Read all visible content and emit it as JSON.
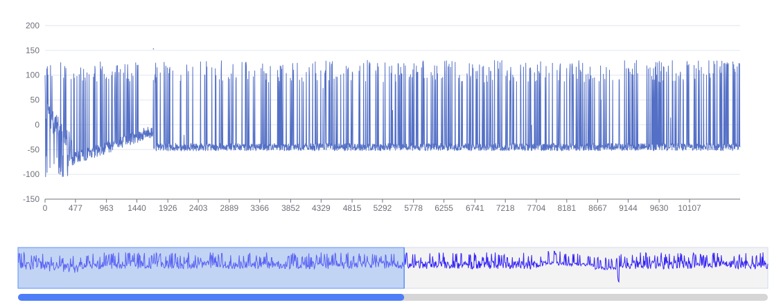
{
  "chart_data": {
    "type": "line",
    "title": "",
    "xlabel": "",
    "ylabel": "",
    "xlim": [
      0,
      10900
    ],
    "ylim": [
      -150,
      200
    ],
    "y_ticks": [
      "200",
      "150",
      "100",
      "50",
      "0",
      "-50",
      "-100",
      "-150"
    ],
    "x_ticks": [
      "0",
      "477",
      "963",
      "1440",
      "1926",
      "2403",
      "2889",
      "3366",
      "3852",
      "4329",
      "4815",
      "5292",
      "5778",
      "6255",
      "6741",
      "7218",
      "7704",
      "8181",
      "8667",
      "9144",
      "9630",
      "10107"
    ],
    "grid": true,
    "series": [
      {
        "color": "#5470c6",
        "description": "dense oscillating signal: segment 0–420 decaying from ~60 to -100 with spikes to ~110; 420–1700 baseline ramps -75 to -10 with spikes to ~130 (max 153 near 1700); after 1700 steady oscillation between about -55 and 120",
        "points": [
          [
            0,
            100
          ],
          [
            40,
            -40
          ],
          [
            80,
            85
          ],
          [
            120,
            -55
          ],
          [
            160,
            110
          ],
          [
            200,
            20
          ],
          [
            240,
            -60
          ],
          [
            280,
            70
          ],
          [
            320,
            -85
          ],
          [
            360,
            -100
          ],
          [
            400,
            40
          ],
          [
            440,
            -65
          ],
          [
            470,
            120
          ],
          [
            520,
            -55
          ],
          [
            560,
            -30
          ],
          [
            600,
            125
          ],
          [
            640,
            -40
          ],
          [
            700,
            128
          ],
          [
            760,
            -30
          ],
          [
            820,
            130
          ],
          [
            880,
            -25
          ],
          [
            940,
            125
          ],
          [
            1000,
            -30
          ],
          [
            1060,
            130
          ],
          [
            1120,
            -20
          ],
          [
            1180,
            128
          ],
          [
            1240,
            -15
          ],
          [
            1300,
            132
          ],
          [
            1360,
            -15
          ],
          [
            1420,
            128
          ],
          [
            1480,
            -10
          ],
          [
            1540,
            130
          ],
          [
            1600,
            -10
          ],
          [
            1660,
            125
          ],
          [
            1700,
            153
          ],
          [
            1730,
            -55
          ],
          [
            1800,
            110
          ],
          [
            1860,
            -50
          ],
          [
            1926,
            120
          ],
          [
            2000,
            -50
          ],
          [
            2100,
            115
          ],
          [
            2200,
            -55
          ],
          [
            2300,
            120
          ],
          [
            2403,
            -45
          ],
          [
            2500,
            118
          ],
          [
            2600,
            -55
          ],
          [
            2700,
            120
          ],
          [
            2800,
            -50
          ],
          [
            2889,
            115
          ],
          [
            3000,
            -60
          ],
          [
            3100,
            120
          ],
          [
            3200,
            -50
          ],
          [
            3366,
            118
          ],
          [
            3500,
            -55
          ],
          [
            3600,
            120
          ],
          [
            3700,
            -50
          ],
          [
            3852,
            115
          ],
          [
            4000,
            -55
          ],
          [
            4100,
            122
          ],
          [
            4200,
            -50
          ],
          [
            4329,
            118
          ],
          [
            4450,
            -55
          ],
          [
            4600,
            120
          ],
          [
            4700,
            -50
          ],
          [
            4815,
            118
          ],
          [
            4950,
            -55
          ],
          [
            5100,
            120
          ],
          [
            5200,
            -50
          ],
          [
            5292,
            120
          ],
          [
            5400,
            -60
          ],
          [
            5500,
            118
          ],
          [
            5650,
            -50
          ],
          [
            5778,
            120
          ],
          [
            5900,
            -55
          ],
          [
            6000,
            118
          ],
          [
            6100,
            -50
          ],
          [
            6255,
            120
          ],
          [
            6400,
            -55
          ],
          [
            6500,
            118
          ],
          [
            6600,
            -50
          ],
          [
            6741,
            120
          ],
          [
            6850,
            -55
          ],
          [
            7000,
            118
          ],
          [
            7100,
            -50
          ],
          [
            7218,
            120
          ],
          [
            7350,
            -55
          ],
          [
            7500,
            118
          ],
          [
            7600,
            -50
          ],
          [
            7704,
            120
          ],
          [
            7850,
            -55
          ],
          [
            8000,
            118
          ],
          [
            8100,
            -50
          ],
          [
            8181,
            120
          ],
          [
            8300,
            -55
          ],
          [
            8450,
            118
          ],
          [
            8550,
            -50
          ],
          [
            8667,
            120
          ],
          [
            8800,
            -55
          ],
          [
            8900,
            118
          ],
          [
            9000,
            -50
          ],
          [
            9144,
            120
          ],
          [
            9300,
            -55
          ],
          [
            9400,
            118
          ],
          [
            9500,
            -50
          ],
          [
            9630,
            120
          ],
          [
            9750,
            -55
          ],
          [
            9900,
            118
          ],
          [
            10000,
            -50
          ],
          [
            10107,
            120
          ],
          [
            10250,
            -55
          ],
          [
            10400,
            118
          ],
          [
            10500,
            -50
          ],
          [
            10600,
            125
          ],
          [
            10700,
            -55
          ],
          [
            10800,
            120
          ],
          [
            10900,
            -45
          ]
        ]
      }
    ],
    "overview": {
      "line_color": "#3323f5",
      "window": [
        0,
        0.515
      ],
      "scrollbar": [
        0,
        0.515
      ]
    }
  }
}
